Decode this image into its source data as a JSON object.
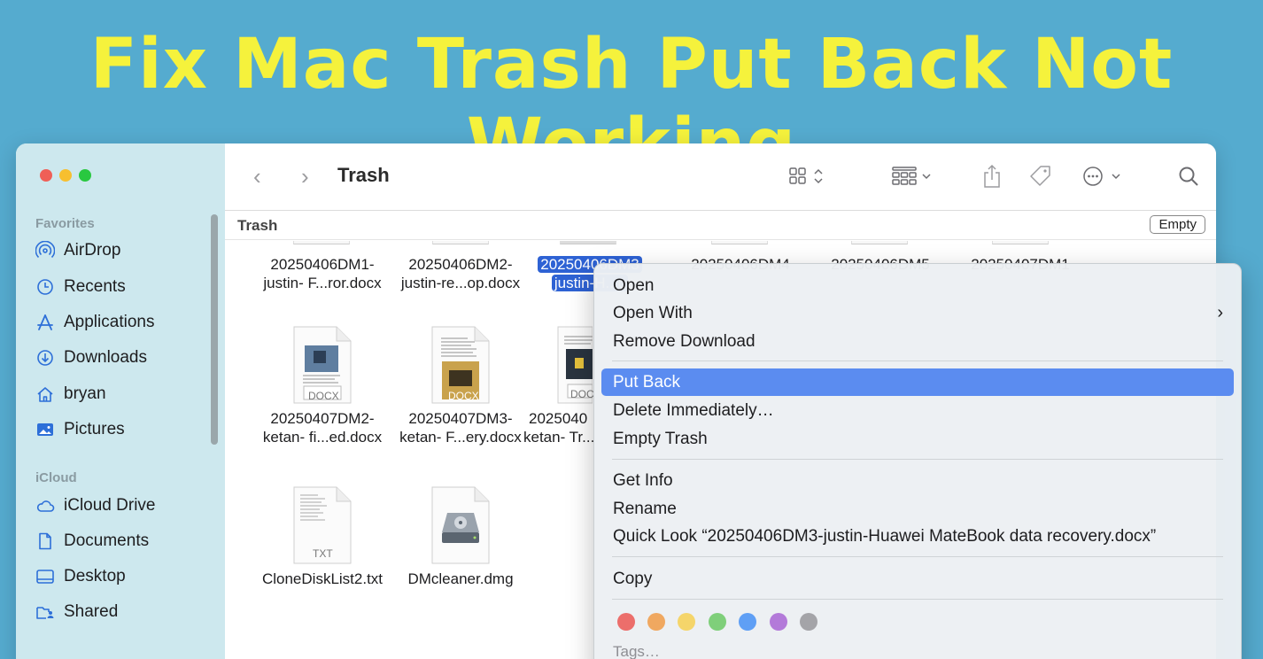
{
  "banner": {
    "title": "Fix Mac Trash Put Back Not Working"
  },
  "window": {
    "title": "Trash",
    "pathbar": "Trash",
    "empty_button": "Empty"
  },
  "sidebar": {
    "favorites_label": "Favorites",
    "favorites": [
      {
        "label": "AirDrop",
        "icon": "airdrop-icon"
      },
      {
        "label": "Recents",
        "icon": "clock-icon"
      },
      {
        "label": "Applications",
        "icon": "applications-icon"
      },
      {
        "label": "Downloads",
        "icon": "download-icon"
      },
      {
        "label": "bryan",
        "icon": "home-icon"
      },
      {
        "label": "Pictures",
        "icon": "photo-icon"
      }
    ],
    "icloud_label": "iCloud",
    "icloud": [
      {
        "label": "iCloud Drive",
        "icon": "cloud-icon"
      },
      {
        "label": "Documents",
        "icon": "document-icon"
      },
      {
        "label": "Desktop",
        "icon": "desktop-icon"
      },
      {
        "label": "Shared",
        "icon": "shared-folder-icon"
      }
    ]
  },
  "files": {
    "row1": [
      {
        "line1": "20250406DM1-",
        "line2": "justin- F...ror.docx"
      },
      {
        "line1": "20250406DM2-",
        "line2": "justin-re...op.docx"
      },
      {
        "line1": "20250406DM3",
        "line2": "justin-H...c"
      },
      {
        "line1": "20250406DM4"
      },
      {
        "line1": "20250406DM5"
      },
      {
        "line1": "20250407DM1"
      }
    ],
    "row2": [
      {
        "line1": "20250407DM2-",
        "line2": "ketan- fi...ed.docx",
        "badge": "DOCX"
      },
      {
        "line1": "20250407DM3-",
        "line2": "ketan- F...ery.docx",
        "badge": "DOCX"
      },
      {
        "line1": "2025040",
        "line2": "ketan- Tr...",
        "badge": "DOC"
      }
    ],
    "row3": [
      {
        "line1": "CloneDiskList2.txt",
        "badge": "TXT"
      },
      {
        "line1": "DMcleaner.dmg"
      }
    ]
  },
  "context_menu": {
    "open": "Open",
    "open_with": "Open With",
    "remove_download": "Remove Download",
    "put_back": "Put Back",
    "delete_immediately": "Delete Immediately…",
    "empty_trash": "Empty Trash",
    "get_info": "Get Info",
    "rename": "Rename",
    "quick_look": "Quick Look “20250406DM3-justin-Huawei MateBook data recovery.docx”",
    "copy": "Copy",
    "tags": "Tags…",
    "tag_colors": [
      "#ec6e6b",
      "#f0a860",
      "#f5d56a",
      "#7fcf7a",
      "#5f9ff5",
      "#b37ad9",
      "#a4a4a8"
    ]
  }
}
